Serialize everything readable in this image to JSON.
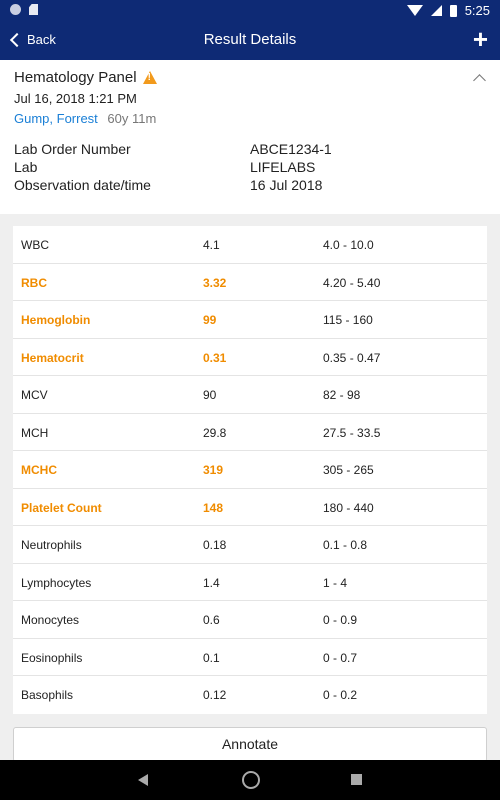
{
  "status_bar": {
    "time": "5:25"
  },
  "app_bar": {
    "back_label": "Back",
    "title": "Result Details",
    "add_label": "+"
  },
  "header": {
    "panel_title": "Hematology Panel",
    "datetime": "Jul 16, 2018 1:21 PM",
    "patient_name": "Gump, Forrest",
    "patient_age": "60y 11m",
    "meta": [
      {
        "key": "Lab Order Number",
        "value": "ABCE1234-1"
      },
      {
        "key": "Lab",
        "value": "LIFELABS"
      },
      {
        "key": "Observation date/time",
        "value": "16 Jul 2018"
      }
    ]
  },
  "results": [
    {
      "name": "WBC",
      "value": "4.1",
      "range": "4.0 - 10.0",
      "abnormal": false
    },
    {
      "name": "RBC",
      "value": "3.32",
      "range": "4.20 - 5.40",
      "abnormal": true
    },
    {
      "name": "Hemoglobin",
      "value": "99",
      "range": "115 - 160",
      "abnormal": true
    },
    {
      "name": "Hematocrit",
      "value": "0.31",
      "range": "0.35 - 0.47",
      "abnormal": true
    },
    {
      "name": "MCV",
      "value": "90",
      "range": "82 - 98",
      "abnormal": false
    },
    {
      "name": "MCH",
      "value": "29.8",
      "range": "27.5 - 33.5",
      "abnormal": false
    },
    {
      "name": "MCHC",
      "value": "319",
      "range": "305 - 265",
      "abnormal": true
    },
    {
      "name": "Platelet Count",
      "value": "148",
      "range": "180 - 440",
      "abnormal": true
    },
    {
      "name": "Neutrophils",
      "value": "0.18",
      "range": "0.1 - 0.8",
      "abnormal": false
    },
    {
      "name": "Lymphocytes",
      "value": "1.4",
      "range": "1 - 4",
      "abnormal": false
    },
    {
      "name": "Monocytes",
      "value": "0.6",
      "range": "0 - 0.9",
      "abnormal": false
    },
    {
      "name": "Eosinophils",
      "value": "0.1",
      "range": "0 - 0.7",
      "abnormal": false
    },
    {
      "name": "Basophils",
      "value": "0.12",
      "range": "0 - 0.2",
      "abnormal": false
    }
  ],
  "annotate_label": "Annotate",
  "colors": {
    "app_bar": "#0e2a75",
    "abnormal": "#f08c00",
    "link": "#1a7fd6",
    "warning": "#f29a1c"
  }
}
